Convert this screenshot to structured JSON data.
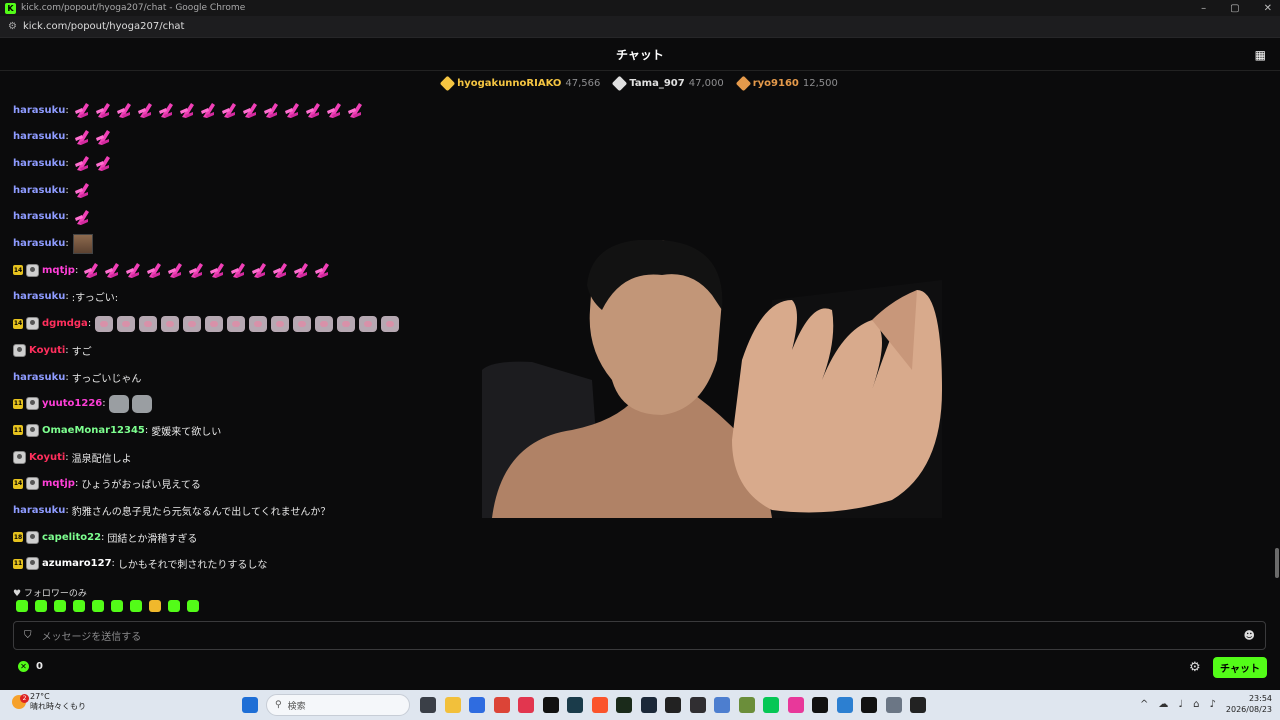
{
  "window": {
    "title": "kick.com/popout/hyoga207/chat - Google Chrome",
    "url": "kick.com/popout/hyoga207/chat",
    "controls": [
      "–",
      "▢",
      "✕"
    ]
  },
  "header": {
    "title": "チャット"
  },
  "leaderboard": [
    {
      "name": "hyogakunnoRIAKO",
      "value": "47,566",
      "color": "#f5c542",
      "icon": "gold-gem-icon"
    },
    {
      "name": "Tama_907",
      "value": "47,000",
      "color": "#e0e0e0",
      "icon": "silver-gem-icon"
    },
    {
      "name": "ryo9160",
      "value": "12,500",
      "color": "#e59a4b",
      "icon": "bronze-gem-icon"
    }
  ],
  "messages": [
    {
      "user": "harasuku",
      "color": "#8e9bff",
      "sub": "",
      "avatar": false,
      "text": "",
      "emote": "pink",
      "count": 14
    },
    {
      "user": "harasuku",
      "color": "#8e9bff",
      "sub": "",
      "avatar": false,
      "text": "",
      "emote": "pink",
      "count": 2
    },
    {
      "user": "harasuku",
      "color": "#8e9bff",
      "sub": "",
      "avatar": false,
      "text": "",
      "emote": "pink",
      "count": 2
    },
    {
      "user": "harasuku",
      "color": "#8e9bff",
      "sub": "",
      "avatar": false,
      "text": "",
      "emote": "pink",
      "count": 1
    },
    {
      "user": "harasuku",
      "color": "#8e9bff",
      "sub": "",
      "avatar": false,
      "text": "",
      "emote": "pink",
      "count": 1
    },
    {
      "user": "harasuku",
      "color": "#8e9bff",
      "sub": "",
      "avatar": false,
      "text": "",
      "emote": "photo",
      "count": 1
    },
    {
      "user": "mqtjp",
      "color": "#ff3fd8",
      "sub": "14",
      "avatar": true,
      "text": "",
      "emote": "pink",
      "count": 12
    },
    {
      "user": "harasuku",
      "color": "#8e9bff",
      "sub": "",
      "avatar": false,
      "text": ":すっごい:",
      "emote": "",
      "count": 0
    },
    {
      "user": "dgmdga",
      "color": "#ff2f5d",
      "sub": "14",
      "avatar": true,
      "text": "",
      "emote": "pig",
      "count": 14
    },
    {
      "user": "Koyuti",
      "color": "#ff2f5d",
      "sub": "",
      "avatar": true,
      "text": "すご",
      "emote": "",
      "count": 0
    },
    {
      "user": "harasuku",
      "color": "#8e9bff",
      "sub": "",
      "avatar": false,
      "text": "すっごいじゃん",
      "emote": "",
      "count": 0
    },
    {
      "user": "yuuto1226",
      "color": "#ff3fd8",
      "sub": "11",
      "avatar": true,
      "text": "",
      "emote": "cat",
      "count": 2
    },
    {
      "user": "OmaeMonar12345",
      "color": "#7dff8f",
      "sub": "11",
      "avatar": true,
      "text": "愛媛来て欲しい",
      "emote": "",
      "count": 0
    },
    {
      "user": "Koyuti",
      "color": "#ff2f5d",
      "sub": "",
      "avatar": true,
      "text": "温泉配信しよ",
      "emote": "",
      "count": 0
    },
    {
      "user": "mqtjp",
      "color": "#ff3fd8",
      "sub": "14",
      "avatar": true,
      "text": "ひょうがおっぱい見えてる",
      "emote": "",
      "count": 0
    },
    {
      "user": "harasuku",
      "color": "#8e9bff",
      "sub": "",
      "avatar": false,
      "text": "豹雅さんの息子見たら元気なるんで出してくれませんか？",
      "emote": "",
      "count": 0
    },
    {
      "user": "capelito22",
      "color": "#7dff8f",
      "sub": "18",
      "avatar": true,
      "text": "団結とか滑稽すぎる",
      "emote": "",
      "count": 0
    },
    {
      "user": "azumaro127",
      "color": "#ffffff",
      "sub": "11",
      "avatar": true,
      "text": "しかもそれで刺されたりするしな",
      "emote": "",
      "count": 0
    }
  ],
  "followers_only": "♥ フォロワーのみ",
  "input": {
    "placeholder": "メッセージを送信する"
  },
  "footer": {
    "points": "0",
    "send_label": "チャット"
  },
  "taskbar": {
    "weather_temp": "27°C",
    "weather_text": "晴れ時々くもり",
    "weather_badge": "2",
    "search_placeholder": "検索",
    "time": "23:54",
    "date": "2026/08/23",
    "apps": [
      {
        "name": "windows-start-icon",
        "color": "#1f6fd6"
      },
      {
        "name": "task-view-icon",
        "color": "#3a3f47"
      },
      {
        "name": "file-explorer-icon",
        "color": "#f2c03b"
      },
      {
        "name": "app-blue-icon",
        "color": "#2f6ce0"
      },
      {
        "name": "chrome-icon",
        "color": "#dc4437"
      },
      {
        "name": "app-red-icon",
        "color": "#e2364f"
      },
      {
        "name": "tiktok-icon",
        "color": "#111111"
      },
      {
        "name": "app-dark-icon",
        "color": "#1a3b4a"
      },
      {
        "name": "brave-icon",
        "color": "#fb542b"
      },
      {
        "name": "app-green-play-icon",
        "color": "#1a2a1a"
      },
      {
        "name": "steam-icon",
        "color": "#1b2838"
      },
      {
        "name": "unity-icon",
        "color": "#222222"
      },
      {
        "name": "obs-icon",
        "color": "#302e31"
      },
      {
        "name": "app-star-icon",
        "color": "#4d7ecf"
      },
      {
        "name": "minecraft-icon",
        "color": "#6b8e3a"
      },
      {
        "name": "line-icon",
        "color": "#06c755"
      },
      {
        "name": "app-pink-icon",
        "color": "#e8389a"
      },
      {
        "name": "unreal-icon",
        "color": "#111111"
      },
      {
        "name": "app-photo-icon",
        "color": "#2c7fd1"
      },
      {
        "name": "app-black-icon",
        "color": "#111111"
      },
      {
        "name": "settings-icon",
        "color": "#6b7685"
      },
      {
        "name": "media-player-icon",
        "color": "#222222"
      }
    ]
  }
}
